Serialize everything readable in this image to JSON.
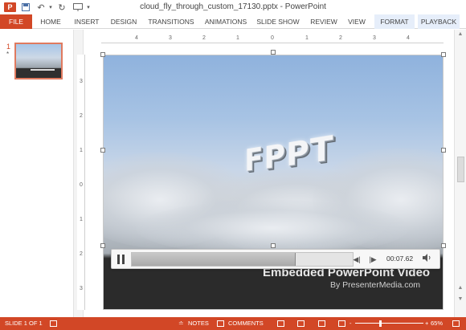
{
  "window": {
    "title": "cloud_fly_through_custom_17130.pptx - PowerPoint",
    "app_icon_letter": "P"
  },
  "quick_access": {
    "save_icon": "save-icon",
    "undo_icon": "undo-icon",
    "redo_icon": "redo-icon",
    "present_icon": "present-icon"
  },
  "ribbon": {
    "tabs": [
      "FILE",
      "HOME",
      "INSERT",
      "DESIGN",
      "TRANSITIONS",
      "ANIMATIONS",
      "SLIDE SHOW",
      "REVIEW",
      "VIEW",
      "FORMAT",
      "PLAYBACK"
    ]
  },
  "thumbnails": {
    "slide_number": "1",
    "marker": "*"
  },
  "ruler": {
    "horizontal": [
      "4",
      "3",
      "2",
      "1",
      "0",
      "1",
      "2",
      "3",
      "4"
    ],
    "vertical": [
      "3",
      "2",
      "1",
      "0",
      "1",
      "2",
      "3"
    ]
  },
  "slide": {
    "logo_text": "FPPT",
    "subtitle": "Embedded PowerPoint Video",
    "byline": "By PresenterMedia.com"
  },
  "video": {
    "progress": 0.74,
    "time": "00:07.62"
  },
  "status": {
    "slide_indicator": "SLIDE 1 OF 1",
    "notes_label": "NOTES",
    "comments_label": "COMMENTS",
    "zoom_minus": "-",
    "zoom_plus": "+",
    "zoom_level": "65%"
  },
  "colors": {
    "accent": "#d24726",
    "context_tab": "#e6eefa"
  }
}
